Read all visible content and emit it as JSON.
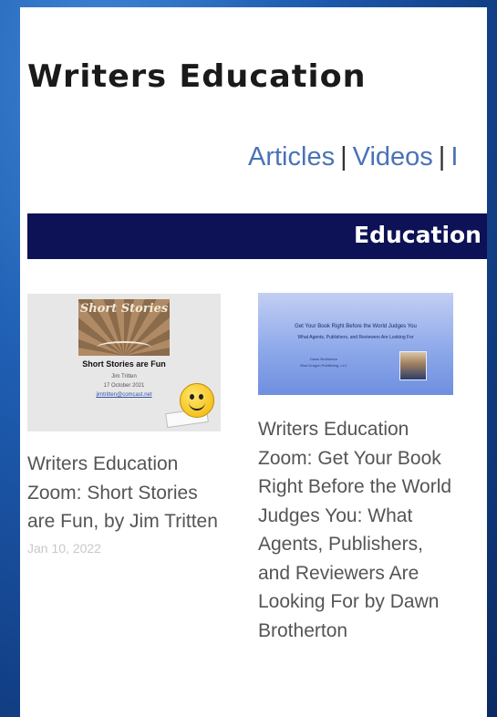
{
  "site": {
    "title": "Writers Education"
  },
  "nav": {
    "items": [
      "Articles",
      "Videos",
      "I"
    ],
    "separator": "|"
  },
  "banner": {
    "label": "Education"
  },
  "posts": [
    {
      "thumbnail": {
        "art_text": "Short Stories",
        "title": "Short Stories are Fun",
        "author": "Jim Tritten",
        "date": "17 October 2021",
        "email": "jimtritten@comcast.net"
      },
      "title": "Writers Education Zoom: Short Stories are Fun, by Jim Tritten",
      "date": "Jan 10, 2022"
    },
    {
      "thumbnail": {
        "title": "Get Your Book Right Before the World Judges You",
        "subtitle": "What Agents, Publishers, and Reviewers Are Looking For",
        "author_line1": "Dawn Brotherton",
        "author_line2": "Blue Dragon Publishing, LLC"
      },
      "title": "Writers Education Zoom: Get Your Book Right Before the World Judges You: What Agents, Publishers, and Reviewers Are Looking For by Dawn Brotherton"
    }
  ],
  "colors": {
    "banner": "#0d1155",
    "nav_link": "#4a72b8",
    "card_text": "#555555"
  }
}
